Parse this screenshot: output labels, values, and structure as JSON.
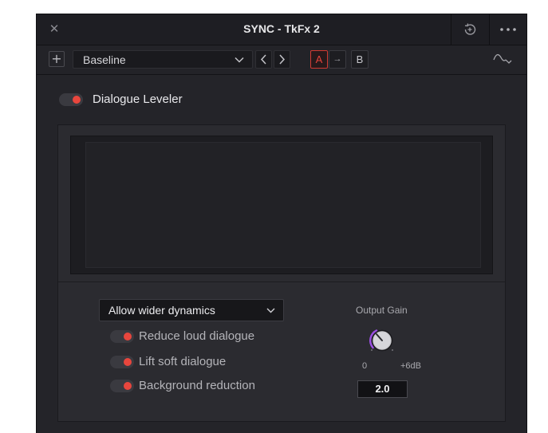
{
  "window": {
    "title": "SYNC - TkFx 2",
    "close_icon": "close-icon",
    "reset_icon": "reset-icon",
    "more_icon": "more-icon"
  },
  "toolbar": {
    "add_label": "+",
    "preset_value": "Baseline",
    "prev_icon": "chevron-left-icon",
    "next_icon": "chevron-right-icon",
    "a_label": "A",
    "copy_arrow": "→",
    "b_label": "B",
    "curve_icon": "curve-icon"
  },
  "plugin": {
    "name": "Dialogue Leveler",
    "enabled": true
  },
  "controls": {
    "mode_value": "Allow wider dynamics",
    "options": [
      {
        "label": "Reduce loud dialogue",
        "on": true
      },
      {
        "label": "Lift soft dialogue",
        "on": true
      },
      {
        "label": "Background reduction",
        "on": true
      }
    ],
    "output_gain": {
      "label": "Output Gain",
      "min_label": "0",
      "max_label": "+6dB",
      "value": "2.0"
    }
  },
  "colors": {
    "panel_bg": "#242429",
    "accent_red": "#e8463d",
    "knob_arc": "#9a4fe0"
  }
}
